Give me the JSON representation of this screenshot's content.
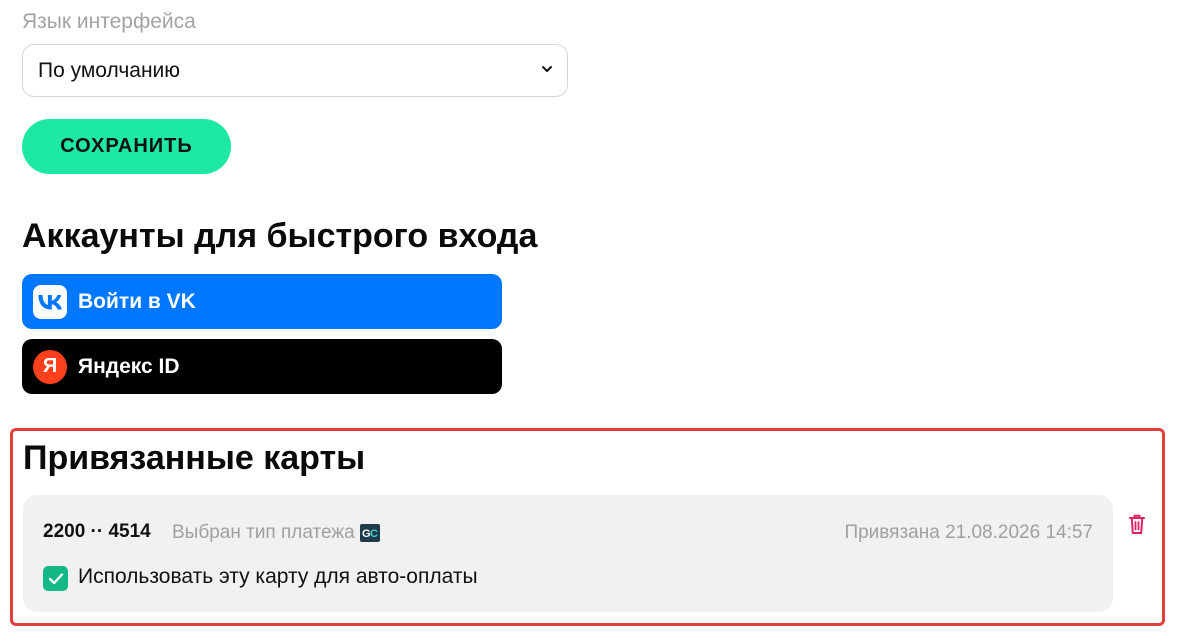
{
  "language": {
    "label": "Язык интерфейса",
    "selected": "По умолчанию"
  },
  "save_button": "СОХРАНИТЬ",
  "quick_login": {
    "title": "Аккаунты для быстрого входа",
    "vk": {
      "label": "Войти в VK",
      "icon": "vk-logo-icon",
      "color": "#0077ff"
    },
    "yandex": {
      "label": "Яндекс ID",
      "icon_letter": "Я",
      "icon": "yandex-logo-icon",
      "color": "#000000"
    }
  },
  "linked_cards": {
    "title": "Привязанные карты",
    "cards": [
      {
        "number": "2200 ·· 4514",
        "payment_type": "Выбран тип платежа",
        "payment_icon": "gc-payment-icon",
        "linked_at": "Привязана 21.08.2026 14:57",
        "auto_pay_label": "Использовать эту карту для авто-оплаты",
        "auto_pay_checked": true
      }
    ]
  },
  "colors": {
    "accent_green": "#1de9a5",
    "checkbox_green": "#12b886",
    "highlight_border": "#e0403a",
    "delete_red": "#e0245e"
  }
}
